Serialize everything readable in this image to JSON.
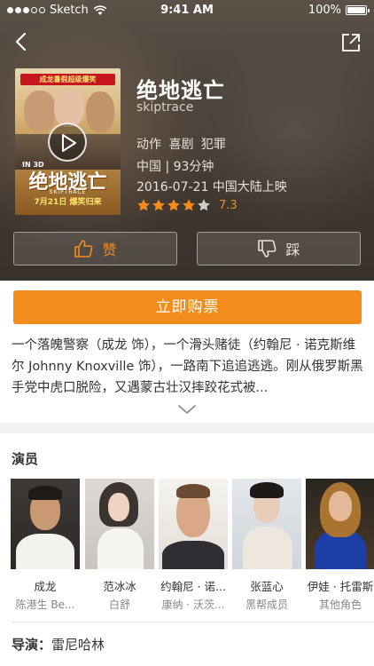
{
  "status_bar": {
    "carrier": "Sketch",
    "time": "9:41 AM",
    "battery": "100%",
    "battery_level": 1.0
  },
  "nav": {
    "back_icon": "chevron-left-icon",
    "share_icon": "share-icon"
  },
  "movie": {
    "title": "绝地逃亡",
    "subtitle": "skiptrace",
    "genres": "动作 喜剧 犯罪",
    "region_duration": "中国 | 93分钟",
    "release": "2016-07-21 中国大陆上映",
    "rating_stars": 4,
    "rating_max": 5,
    "score": "7.3",
    "poster": {
      "banner": "成龙暑假超级爆笑",
      "tag": "IN 3D",
      "title": "绝地逃亡",
      "sub": "SKIPTRACE",
      "date": "7月21日 爆笑归来"
    }
  },
  "actions": {
    "like_label": "赞",
    "dislike_label": "踩"
  },
  "buy_label": "立即购票",
  "description": "一个落魄警察（成龙 饰），一个滑头赌徒（约翰尼 · 诺克斯维尔 Johnny Knoxville 饰），一路南下追追逃逃。刚从俄罗斯黑手党中虎口脱险，又遇蒙古壮汉摔跤花式被...",
  "cast_heading": "演员",
  "cast": [
    {
      "name": "成龙",
      "role": "陈港生  Be..."
    },
    {
      "name": "范冰冰",
      "role": "白舒"
    },
    {
      "name": "约翰尼 · 诺...",
      "role": "康纳 · 沃茨..."
    },
    {
      "name": "张蓝心",
      "role": "黑帮成员"
    },
    {
      "name": "伊娃 · 托雷斯",
      "role": "其他角色"
    }
  ],
  "director": {
    "label": "导演：",
    "name": "雷尼哈林"
  },
  "colors": {
    "accent": "#f38c1a",
    "hero_bg": "#4a4139"
  }
}
